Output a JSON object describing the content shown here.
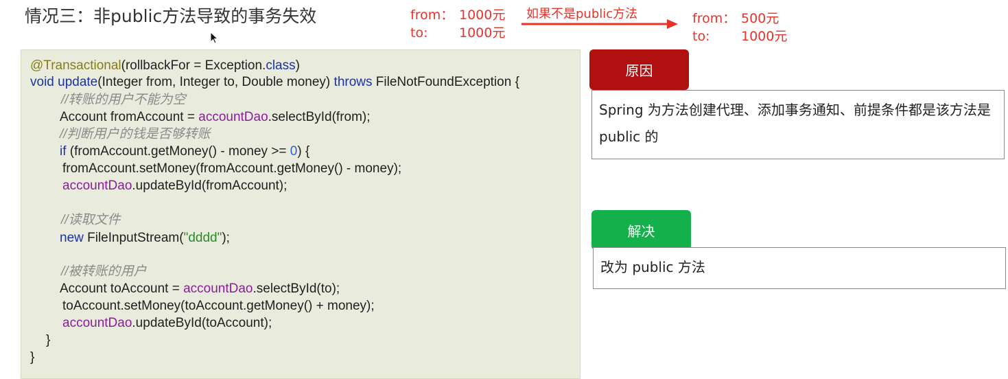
{
  "title": "情况三：非public方法导致的事务失效",
  "balances_before": {
    "from_label": "from：",
    "from_value": "1000元",
    "to_label": "to:",
    "to_value": "1000元"
  },
  "arrow_label": "如果不是public方法",
  "balances_after": {
    "from_label": "from：",
    "from_value": "500元",
    "to_label": "to:",
    "to_value": "1000元"
  },
  "code": {
    "l1_ann": "@Transactional",
    "l1_a": "(rollbackFor = Exception.",
    "l1_kw": "class",
    "l1_b": ")",
    "l2_kw1": "void ",
    "l2_fn": "update",
    "l2_a": "(Integer from, Integer to, Double money) ",
    "l2_kw2": "throws",
    "l2_b": " FileNotFoundException {",
    "l3_cmt": "//转账的用户不能为空",
    "l4_a": "Account fromAccount = ",
    "l4_fld": "accountDao",
    "l4_b": ".selectById(from);",
    "l5_cmt": "//判断用户的钱是否够转账",
    "l6_kw": "if",
    "l6_a": " (fromAccount.getMoney() - money >= ",
    "l6_num": "0",
    "l6_b": ") {",
    "l7": "fromAccount.setMoney(fromAccount.getMoney() - money);",
    "l8_fld": "accountDao",
    "l8_b": ".updateById(fromAccount);",
    "l9_cmt": "//读取文件",
    "l10_kw": "new",
    "l10_a": " FileInputStream(",
    "l10_str": "\"dddd\"",
    "l10_b": ");",
    "l11_cmt": "//被转账的用户",
    "l12_a": "Account toAccount = ",
    "l12_fld": "accountDao",
    "l12_b": ".selectById(to);",
    "l13": "toAccount.setMoney(toAccount.getMoney() + money);",
    "l14_fld": "accountDao",
    "l14_b": ".updateById(toAccount);",
    "l15": "}",
    "l16": "}"
  },
  "reason": {
    "tag": "原因",
    "text": "Spring 为方法创建代理、添加事务通知、前提条件都是该方法是 public 的"
  },
  "solution": {
    "tag": "解决",
    "text": "改为 public 方法"
  },
  "colors": {
    "annotation_red": "#e8332a",
    "reason_tag": "#b01010",
    "solution_tag": "#14b04c",
    "code_background": "#e9ecdd"
  },
  "icons": [
    "mouse-cursor-icon",
    "right-arrow-icon"
  ]
}
